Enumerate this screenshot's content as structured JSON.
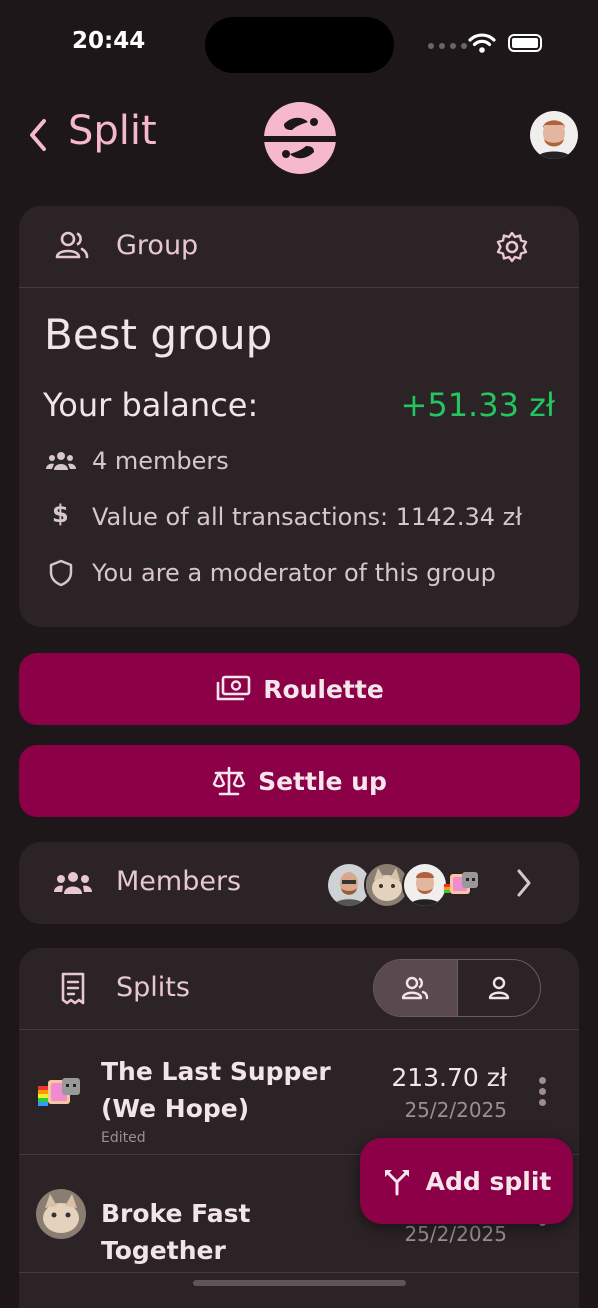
{
  "status": {
    "time": "20:44"
  },
  "header": {
    "title": "Split",
    "back_icon": "chevron-left-icon",
    "accent": "#f5b8cd"
  },
  "group": {
    "section_label": "Group",
    "name": "Best group",
    "balance_label": "Your balance:",
    "balance_value": "+51.33 zł",
    "balance_color": "#22c55e",
    "members_count": "4 members",
    "transactions_value": "Value of all transactions: 1142.34 zł",
    "moderator_text": "You are a moderator of this group"
  },
  "actions": {
    "roulette_label": "Roulette",
    "settle_label": "Settle up",
    "button_color": "#8c0047"
  },
  "members": {
    "label": "Members"
  },
  "splits": {
    "label": "Splits",
    "items": [
      {
        "name": "The Last Supper (We Hope)",
        "edited": "Edited",
        "amount": "213.70 zł",
        "date": "25/2/2025"
      },
      {
        "name": "Broke Fast Together",
        "amount": "",
        "date": "25/2/2025"
      }
    ]
  },
  "fab": {
    "label": "Add split"
  }
}
